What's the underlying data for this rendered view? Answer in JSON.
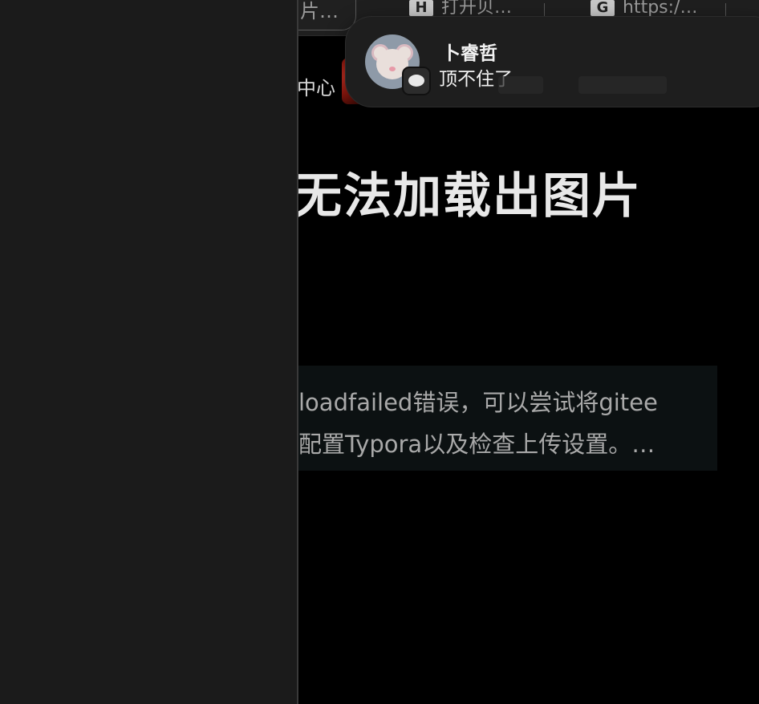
{
  "browser": {
    "tabs": [
      {
        "label": "片…",
        "favicon": ""
      },
      {
        "label": "打开贝…",
        "favicon": "H"
      },
      {
        "label": "https:/…",
        "favicon": "G"
      }
    ]
  },
  "site_nav": {
    "center_label": "中心"
  },
  "article": {
    "title": "无法加载出图片",
    "summary_lines": [
      "loadfailed错误，可以尝试将gitee",
      "配置Typora以及检查上传设置。…"
    ]
  },
  "notification": {
    "sender": "卜睿哲",
    "message": "顶不住了",
    "avatar_icon": "mouse-memoji-icon",
    "app_icon": "messages-icon"
  },
  "colors": {
    "left_panel_bg": "#1b1b1b",
    "page_bg": "#000000",
    "summary_bg": "#0c1112",
    "notification_bg": "#1e1e1e",
    "accent_red": "#b3301c"
  }
}
